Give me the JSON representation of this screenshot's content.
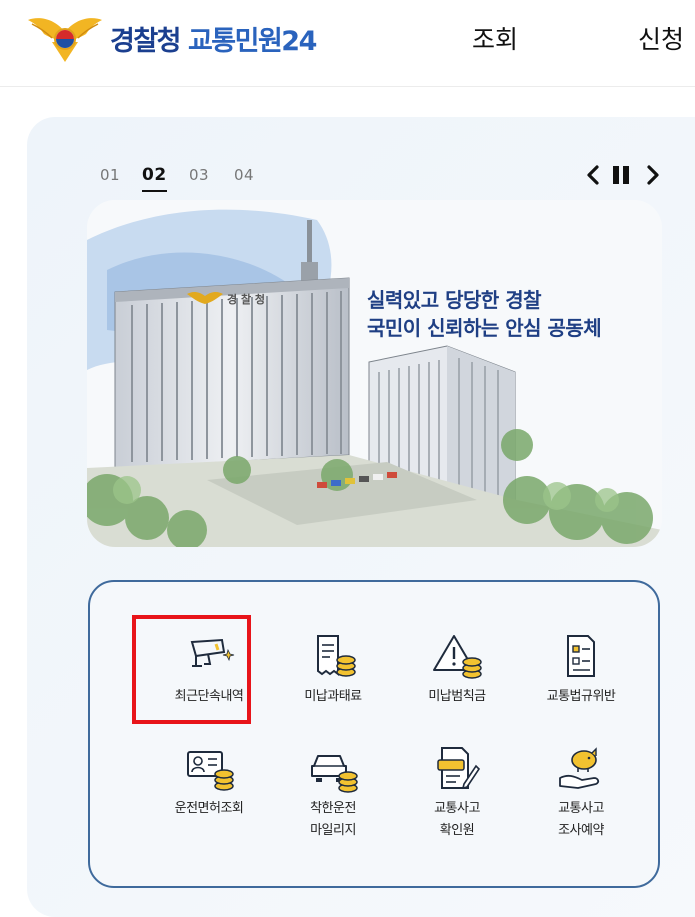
{
  "header": {
    "brand_main": "경찰청",
    "brand_sub": "교통민원24",
    "nav": [
      "조회",
      "신청"
    ]
  },
  "carousel": {
    "slides": [
      "01",
      "02",
      "03",
      "04"
    ],
    "active_index": 1,
    "banner_line1": "실력있고 당당한 경찰",
    "banner_line2": "국민이 신뢰하는 안심 공동체",
    "building_sign": "경 찰 청"
  },
  "services": {
    "row1": [
      {
        "label": "최근단속내역",
        "icon": "cctv-camera-icon"
      },
      {
        "label": "미납과태료",
        "icon": "receipt-coins-icon"
      },
      {
        "label": "미납범칙금",
        "icon": "warning-coins-icon"
      },
      {
        "label": "교통법규위반",
        "icon": "checklist-document-icon"
      }
    ],
    "row2": [
      {
        "label": "운전면허조회",
        "icon": "id-card-coins-icon"
      },
      {
        "label": "착한운전 마일리지",
        "label_line1": "착한운전",
        "label_line2": "마일리지",
        "icon": "car-coins-icon"
      },
      {
        "label": "교통사고 확인원",
        "label_line1": "교통사고",
        "label_line2": "확인원",
        "icon": "accident-document-icon"
      },
      {
        "label": "교통사고 조사예약",
        "label_line1": "교통사고",
        "label_line2": "조사예약",
        "icon": "piggy-bank-hand-icon"
      }
    ]
  },
  "colors": {
    "brand_blue": "#1b3f8f",
    "panel_border": "#3f6a9c",
    "highlight_red": "#e8141a",
    "icon_gold": "#f2c230"
  }
}
